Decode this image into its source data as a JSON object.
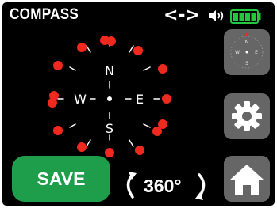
{
  "header": {
    "title": "COMPASS",
    "nav_arrows": "<->"
  },
  "compass": {
    "north": "N",
    "south": "S",
    "east": "E",
    "west": "W"
  },
  "mini_compass": {
    "north": "N",
    "south": "S",
    "east": "E",
    "west": "W"
  },
  "controls": {
    "save_label": "SAVE",
    "rotation_label": "360°"
  },
  "colors": {
    "background": "#000000",
    "marker": "#f0291f",
    "save_button": "#1e9e4a",
    "side_button": "#666666",
    "battery": "#22c83c"
  },
  "icons": [
    "speaker-icon",
    "battery-icon",
    "gear-icon",
    "home-icon",
    "rotate-icon"
  ]
}
